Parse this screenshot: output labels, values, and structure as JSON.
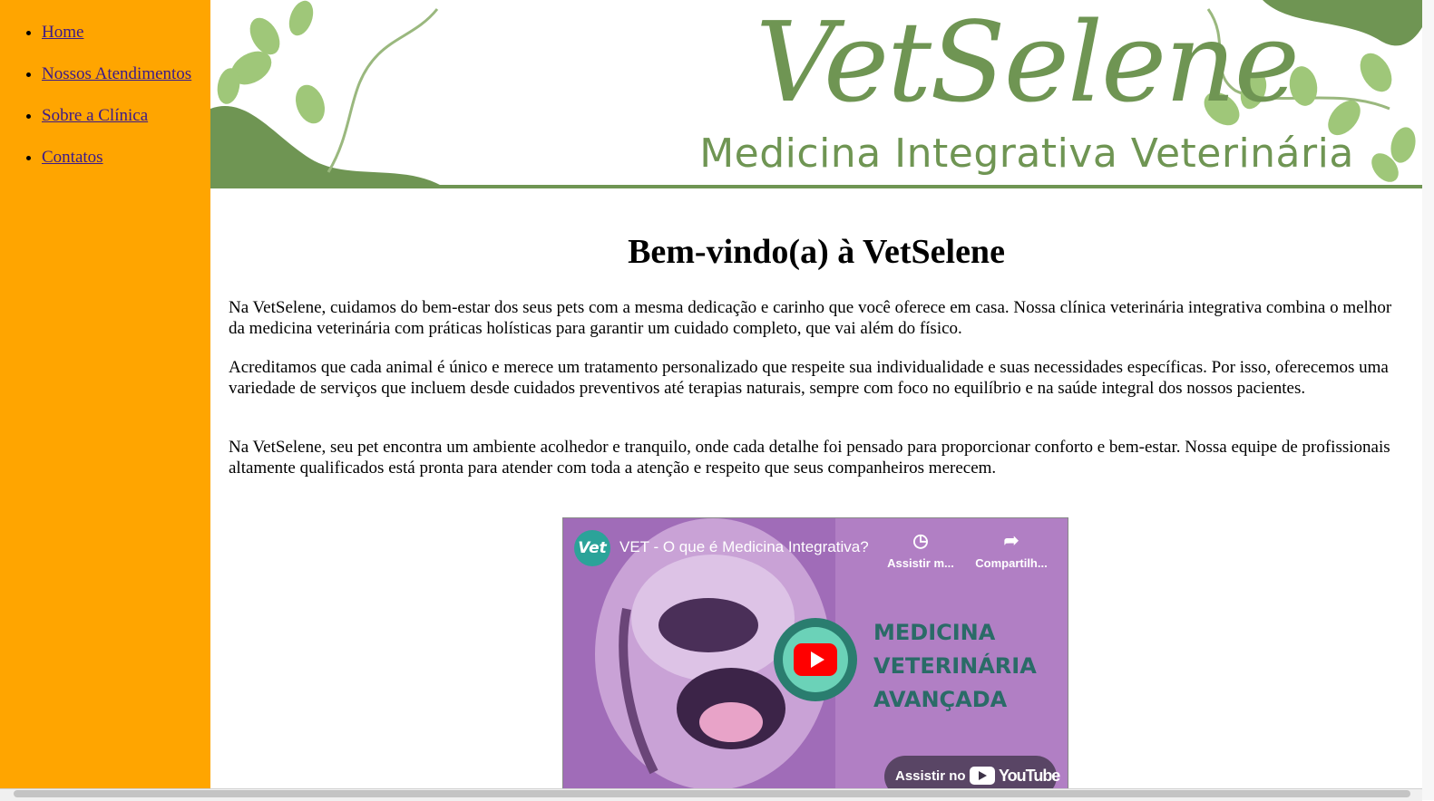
{
  "nav": {
    "items": [
      {
        "label": "Home"
      },
      {
        "label": "Nossos Atendimentos"
      },
      {
        "label": "Sobre a Clínica"
      },
      {
        "label": "Contatos"
      }
    ]
  },
  "banner": {
    "brand_name": "VetSelene",
    "tagline": "Medicina Integrativa Veterinária",
    "color": "#6f9553"
  },
  "main": {
    "heading": "Bem-vindo(a) à VetSelene",
    "paragraphs": [
      "Na VetSelene, cuidamos do bem-estar dos seus pets com a mesma dedicação e carinho que você oferece em casa. Nossa clínica veterinária integrativa combina o melhor da medicina veterinária com práticas holísticas para garantir um cuidado completo, que vai além do físico.",
      "Acreditamos que cada animal é único e merece um tratamento personalizado que respeite sua individualidade e suas necessidades específicas. Por isso, oferecemos uma variedade de serviços que incluem desde cuidados preventivos até terapias naturais, sempre com foco no equilíbrio e na saúde integral dos nossos pacientes.",
      "Na VetSelene, seu pet encontra um ambiente acolhedor e tranquilo, onde cada detalhe foi pensado para proporcionar conforto e bem-estar. Nossa equipe de profissionais altamente qualificados está pronta para atender com toda a atenção e respeito que seus companheiros merecem."
    ]
  },
  "video": {
    "channel_logo_text": "Vet",
    "title": "VET - O que é Medicina Integrativa?",
    "watch_later_label": "Assistir m...",
    "share_label": "Compartilh...",
    "overlay_lines": [
      "MEDICINA",
      "VETERINÁRIA",
      "AVANÇADA"
    ],
    "watch_on_label": "Assistir no",
    "youtube_label": "YouTube"
  },
  "colors": {
    "sidebar": "#ffa500",
    "link": "#3b1a8a",
    "accent": "#6f9553"
  }
}
